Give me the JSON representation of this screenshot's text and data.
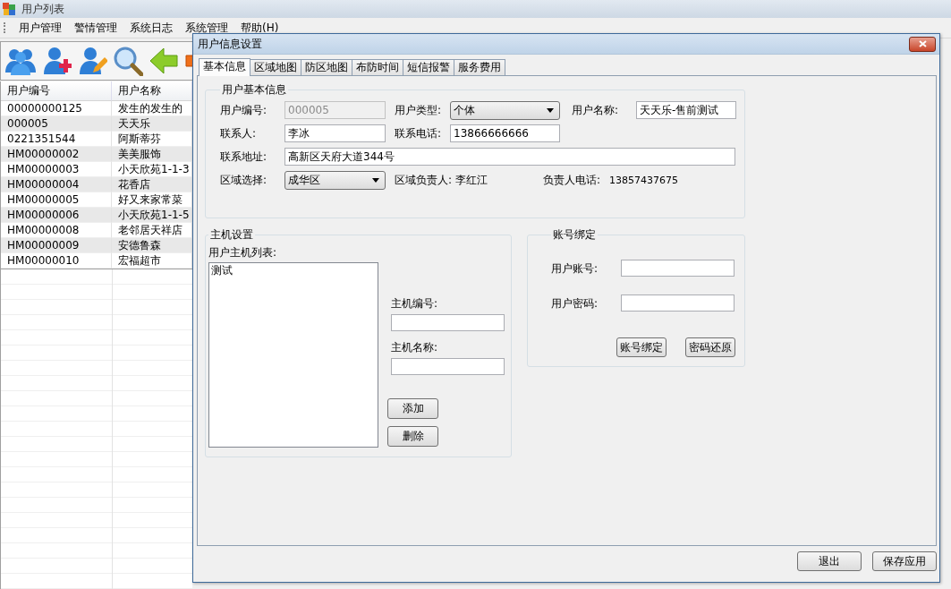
{
  "main_window": {
    "title": "用户列表",
    "menu": [
      "用户管理",
      "警情管理",
      "系统日志",
      "系统管理",
      "帮助(H)"
    ],
    "user_table": {
      "columns": [
        "用户编号",
        "用户名称"
      ],
      "rows": [
        [
          "00000000125",
          "发生的发生的"
        ],
        [
          "000005",
          "天天乐"
        ],
        [
          "0221351544",
          "阿斯蒂芬"
        ],
        [
          "HM00000002",
          "美美服饰"
        ],
        [
          "HM00000003",
          "小天欣苑1-1-3"
        ],
        [
          "HM00000004",
          "花香店"
        ],
        [
          "HM00000005",
          "好又来家常菜"
        ],
        [
          "HM00000006",
          "小天欣苑1-1-5"
        ],
        [
          "HM00000008",
          "老邻居天祥店"
        ],
        [
          "HM00000009",
          "安德鲁森"
        ],
        [
          "HM00000010",
          "宏福超市"
        ]
      ]
    }
  },
  "dialog": {
    "title": "用户信息设置",
    "tabs": [
      {
        "label": "基本信息",
        "selected": true
      },
      {
        "label": "区域地图",
        "selected": false
      },
      {
        "label": "防区地图",
        "selected": false
      },
      {
        "label": "布防时间",
        "selected": false
      },
      {
        "label": "短信报警",
        "selected": false
      },
      {
        "label": "服务费用",
        "selected": false
      }
    ],
    "basic_info": {
      "title": "用户基本信息",
      "user_id": {
        "label": "用户编号:",
        "value": "000005",
        "disabled": true
      },
      "user_type": {
        "label": "用户类型:",
        "value": "个体"
      },
      "user_name": {
        "label": "用户名称:",
        "value": "天天乐-售前测试"
      },
      "contact": {
        "label": "联系人:",
        "value": "李冰"
      },
      "phone": {
        "label": "联系电话:",
        "value": "13866666666"
      },
      "address": {
        "label": "联系地址:",
        "value": "高新区天府大道344号"
      },
      "region": {
        "label": "区域选择:",
        "value": "成华区"
      },
      "region_manager": {
        "label": "区域负责人:",
        "value": "李红江"
      },
      "manager_phone": {
        "label": "负责人电话:",
        "value": "13857437675"
      }
    },
    "host_settings": {
      "title": "主机设置",
      "list_label": "用户主机列表:",
      "hosts": [
        "测试"
      ],
      "host_id": {
        "label": "主机编号:"
      },
      "host_name": {
        "label": "主机名称:"
      },
      "buttons": [
        "添加",
        "删除"
      ]
    },
    "account_binding": {
      "title": "账号绑定",
      "account": {
        "label": "用户账号:"
      },
      "password": {
        "label": "用户密码:"
      },
      "buttons": [
        "账号绑定",
        "密码还原"
      ]
    },
    "buttons": [
      "退出",
      "保存应用"
    ]
  }
}
